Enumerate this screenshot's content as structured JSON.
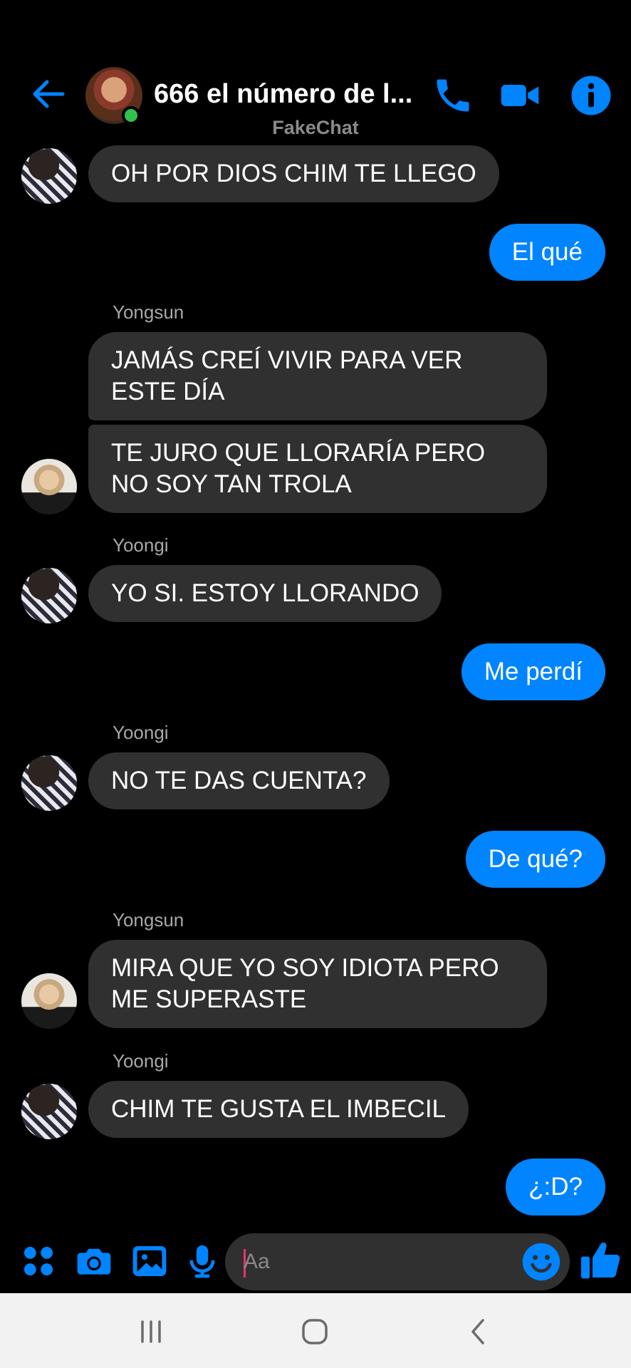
{
  "header": {
    "title": "666 el número de l...",
    "subtitle": "FakeChat"
  },
  "colors": {
    "accent": "#0084ff",
    "incoming_bubble": "#303030",
    "background": "#000000",
    "online": "#31c24d"
  },
  "messages": [
    {
      "dir": "in",
      "sender": "",
      "avatar": "yoongi",
      "text": "OH POR DIOS CHIM TE LLEGO"
    },
    {
      "dir": "out",
      "text": "El qué"
    },
    {
      "dir": "in",
      "sender": "Yongsun",
      "text": "JAMÁS CREÍ VIVIR PARA VER ESTE DÍA"
    },
    {
      "dir": "in",
      "sender": "",
      "avatar": "yongsun",
      "text": "TE JURO QUE LLORARÍA PERO NO SOY TAN TROLA"
    },
    {
      "dir": "in",
      "sender": "Yoongi",
      "avatar": "yoongi",
      "text": "YO SI. ESTOY LLORANDO"
    },
    {
      "dir": "out",
      "text": "Me perdí"
    },
    {
      "dir": "in",
      "sender": "Yoongi",
      "avatar": "yoongi",
      "text": "NO TE DAS CUENTA?"
    },
    {
      "dir": "out",
      "text": "De qué?"
    },
    {
      "dir": "in",
      "sender": "Yongsun",
      "avatar": "yongsun",
      "text": "MIRA QUE YO SOY IDIOTA PERO ME SUPERASTE"
    },
    {
      "dir": "in",
      "sender": "Yoongi",
      "avatar": "yoongi",
      "text": "CHIM TE GUSTA EL IMBECIL"
    },
    {
      "dir": "out",
      "text": "¿:D?"
    }
  ],
  "composer": {
    "placeholder": "Aa"
  },
  "icons": {
    "back": "back-arrow-icon",
    "call": "phone-icon",
    "video": "video-camera-icon",
    "info": "info-icon",
    "apps": "apps-grid-icon",
    "camera": "camera-icon",
    "gallery": "image-icon",
    "mic": "microphone-icon",
    "emoji": "emoji-icon",
    "like": "thumbs-up-icon"
  }
}
